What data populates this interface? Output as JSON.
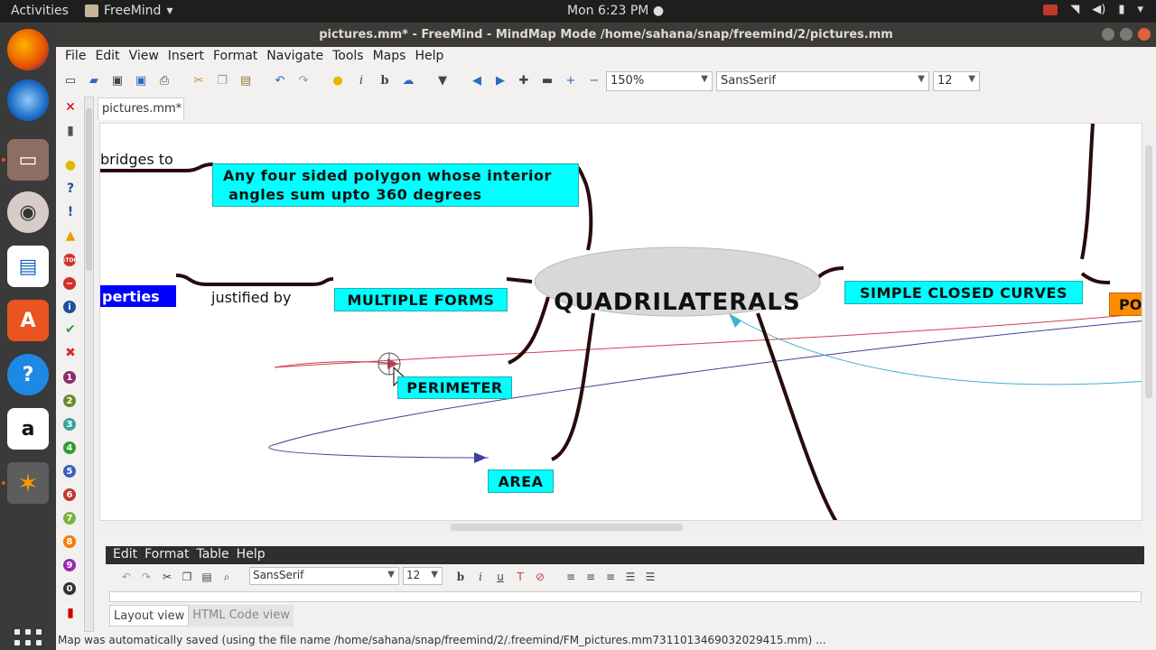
{
  "topbar": {
    "activities": "Activities",
    "app_name": "FreeMind",
    "clock": "Mon  6:23 PM ●"
  },
  "window": {
    "title": "pictures.mm* - FreeMind - MindMap Mode /home/sahana/snap/freemind/2/pictures.mm"
  },
  "menubar": [
    "File",
    "Edit",
    "View",
    "Insert",
    "Format",
    "Navigate",
    "Tools",
    "Maps",
    "Help"
  ],
  "toolbar": {
    "zoom": "150%",
    "font": "SansSerif",
    "size": "12"
  },
  "palette_numbers": [
    "1",
    "2",
    "3",
    "4",
    "5",
    "6",
    "7",
    "8",
    "9",
    "0"
  ],
  "doc_tab": "pictures.mm*",
  "map": {
    "root": "QUADRILATERALS",
    "nodes": {
      "definition_line1": "Any four sided polygon whose interior",
      "definition_line2": " angles sum upto 360 degrees",
      "multiple_forms": "MULTIPLE FORMS",
      "perimeter": "PERIMETER",
      "area": "AREA",
      "simple_closed_curves": "SIMPLE  CLOSED CURVES",
      "properties_partial": "perties",
      "po_partial": "PO"
    },
    "labels": {
      "bridges_to": "bridges to",
      "justified_by": "justified by"
    },
    "colors": {
      "node_cyan": "#00ffff",
      "node_blue": "#0000ff",
      "node_orange": "#ff8c00",
      "root_fill": "#d8d8d8",
      "edge": "#2a0a0a",
      "link_red": "#d04050",
      "link_blue": "#4040a0",
      "link_cyan": "#40b0d0"
    }
  },
  "notes": {
    "menu": [
      "Edit",
      "Format",
      "Table",
      "Help"
    ],
    "font": "SansSerif",
    "size": "12",
    "tab_layout": "Layout view",
    "tab_html": "HTML Code view"
  },
  "status": "Map was automatically saved (using the file name /home/sahana/snap/freemind/2/.freemind/FM_pictures.mm7311013469032029415.mm) ..."
}
